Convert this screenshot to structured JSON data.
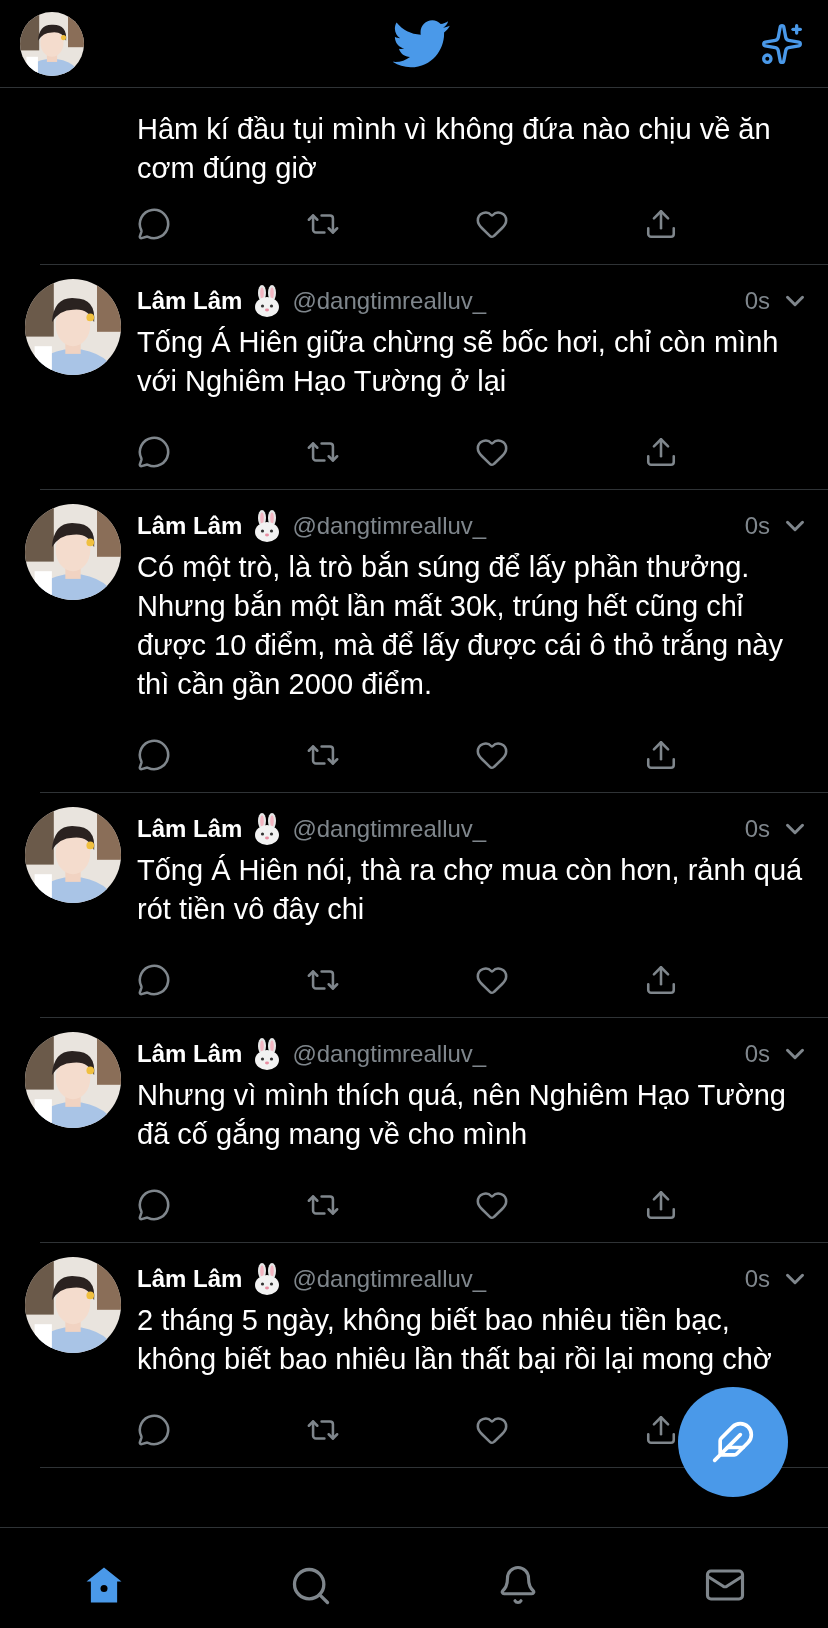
{
  "tweets": [
    {
      "kind": "continued",
      "body": "Hâm kí đầu tụi mình vì không đứa nào chịu về ăn cơm đúng giờ"
    },
    {
      "kind": "full",
      "name": "Lâm Lâm",
      "handle": "@dangtimrealluv_",
      "time": "0s",
      "body": "Tống Á Hiên giữa chừng sẽ bốc hơi, chỉ còn mình với Nghiêm Hạo Tường ở lại"
    },
    {
      "kind": "full",
      "name": "Lâm Lâm",
      "handle": "@dangtimrealluv_",
      "time": "0s",
      "body": "Có một trò, là trò bắn súng để lấy phần thưởng. Nhưng bắn một lần mất 30k, trúng hết cũng chỉ được 10 điểm, mà để lấy được cái ô thỏ trắng này thì cần gần 2000 điểm."
    },
    {
      "kind": "full",
      "name": "Lâm Lâm",
      "handle": "@dangtimrealluv_",
      "time": "0s",
      "body": "Tống Á Hiên nói, thà ra chợ mua còn hơn, rảnh quá rót tiền vô đây chi"
    },
    {
      "kind": "full",
      "name": "Lâm Lâm",
      "handle": "@dangtimrealluv_",
      "time": "0s",
      "body": "Nhưng vì mình thích quá, nên Nghiêm Hạo Tường đã cố gắng mang về cho mình"
    },
    {
      "kind": "full",
      "name": "Lâm Lâm",
      "handle": "@dangtimrealluv_",
      "time": "0s",
      "body": "2 tháng 5 ngày, không biết bao nhiêu tiền bạc, không biết bao nhiêu lần thất bại rồi lại mong chờ"
    }
  ],
  "nav": [
    {
      "kind": "home",
      "selected": true
    },
    {
      "kind": "search",
      "selected": false
    },
    {
      "kind": "notifications",
      "selected": false
    },
    {
      "kind": "messages",
      "selected": false
    }
  ]
}
